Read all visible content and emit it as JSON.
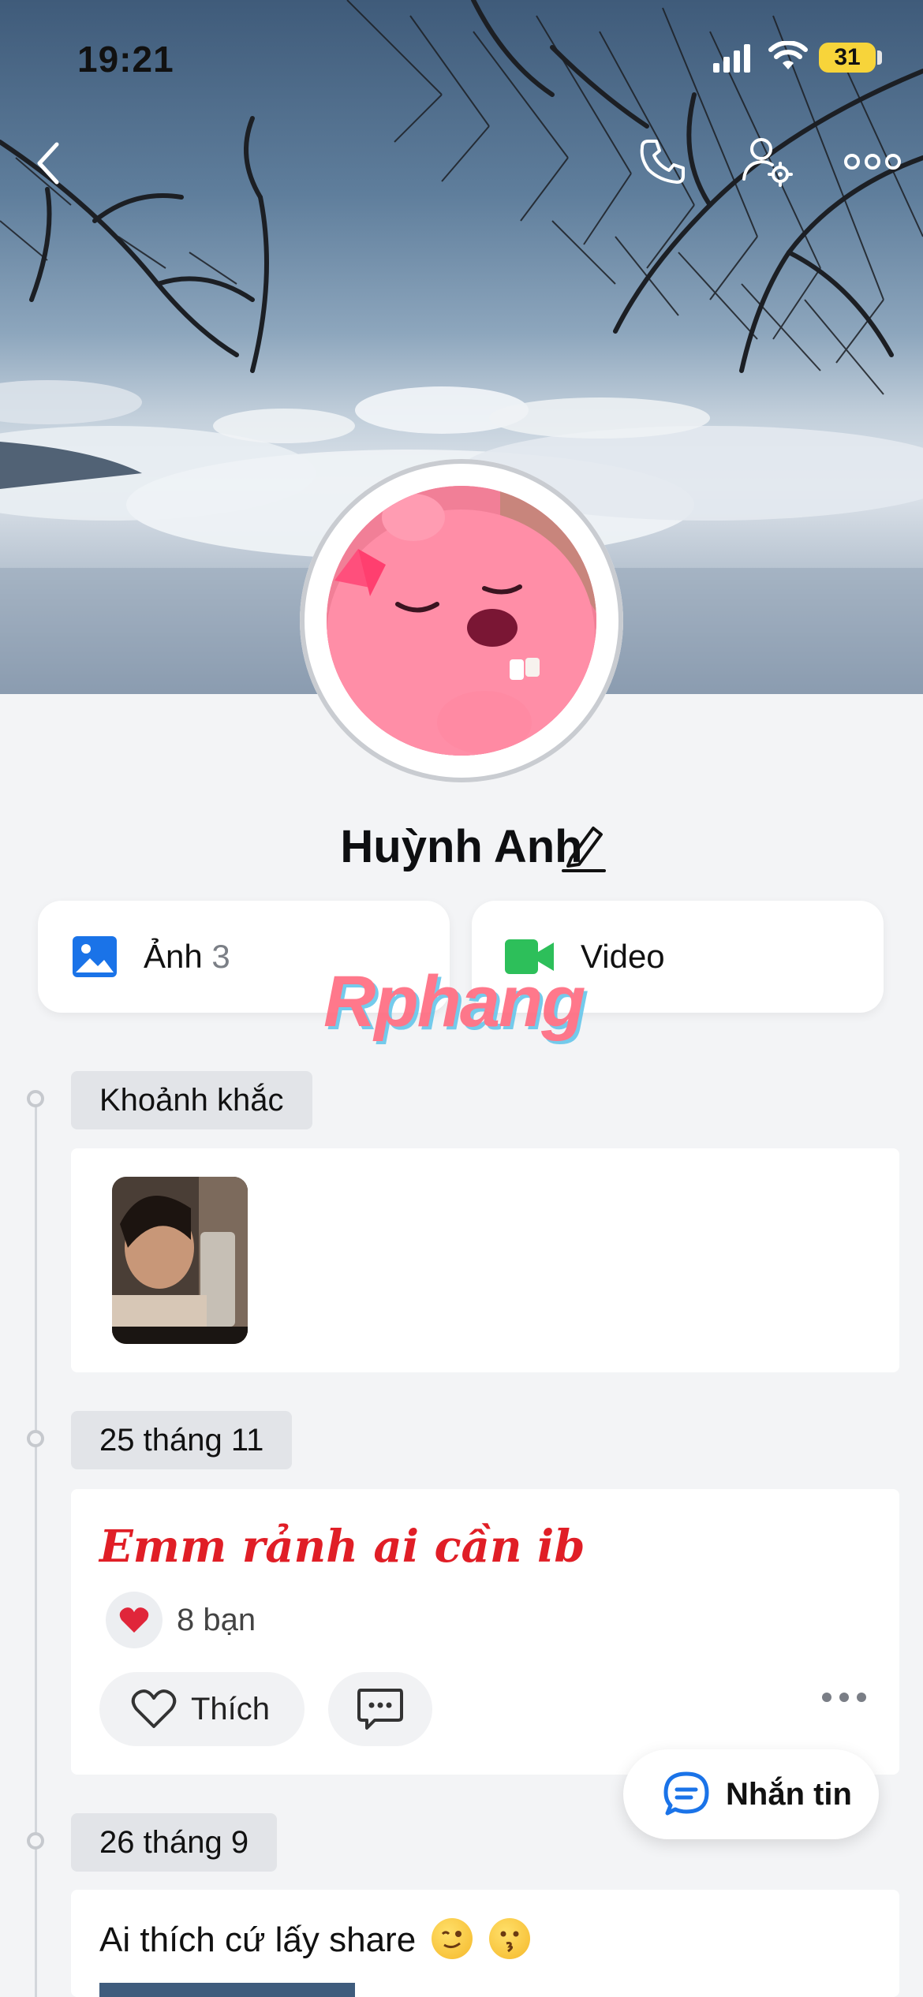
{
  "status_bar": {
    "time": "19:21",
    "battery": "31"
  },
  "header": {
    "back_icon": "chevron-left-icon",
    "actions": [
      "phone-icon",
      "user-settings-icon",
      "more-horizontal-icon"
    ]
  },
  "profile": {
    "name": "Huỳnh Anh"
  },
  "media": {
    "photos_label": "Ảnh",
    "photos_count": "3",
    "video_label": "Video"
  },
  "watermark": "Rphang",
  "timeline": {
    "moments_label": "Khoảnh khắc",
    "post1_date": "25 tháng 11",
    "post1_text": "Emm rảnh ai cần ib",
    "post1_reaction_count": "8 bạn",
    "like_label": "Thích",
    "post2_date": "26 tháng 9",
    "post2_text": "Ai thích cứ lấy share"
  },
  "fab": {
    "message_label": "Nhắn tin"
  },
  "colors": {
    "accent_blue": "#1a73e8",
    "video_green": "#2dbf5a",
    "post_red": "#e01e26",
    "battery_yellow": "#f7d43a"
  }
}
